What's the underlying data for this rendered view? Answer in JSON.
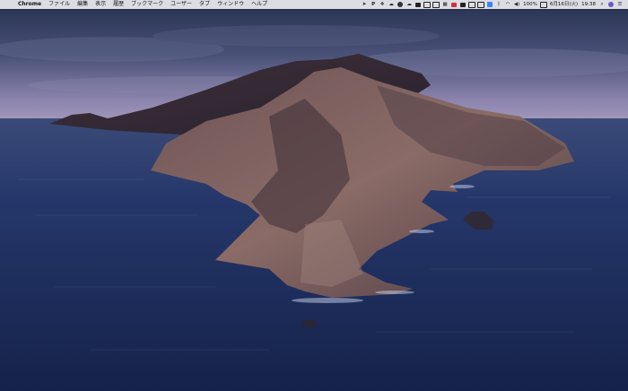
{
  "menubar": {
    "apple_glyph": "",
    "app_name": "Chrome",
    "menus": [
      "ファイル",
      "編集",
      "表示",
      "履歴",
      "ブックマーク",
      "ユーザー",
      "タブ",
      "ウィンドウ",
      "ヘルプ"
    ],
    "tray": {
      "battery_percent": "100%",
      "date": "6月16日(火)",
      "time": "19:38"
    }
  },
  "colors": {
    "menubar_bg": "#ececf0",
    "sky_top": "#2a3352",
    "sky_horizon": "#9a8fb6",
    "sea": "#1f2d55",
    "island": "#5a4548"
  },
  "icons": [
    "location-arrow-icon",
    "p-icon",
    "dropbox-icon",
    "cloud-icon",
    "creative-cloud-icon",
    "cloud-dark-icon",
    "stack-icon",
    "notes-icon",
    "screen-icon",
    "grid-icon",
    "shield-icon",
    "chat-icon",
    "keyboard-icon",
    "display-icon",
    "a-icon",
    "bluetooth-icon",
    "wifi-icon",
    "volume-icon",
    "search-icon",
    "siri-icon",
    "notification-center-icon"
  ]
}
